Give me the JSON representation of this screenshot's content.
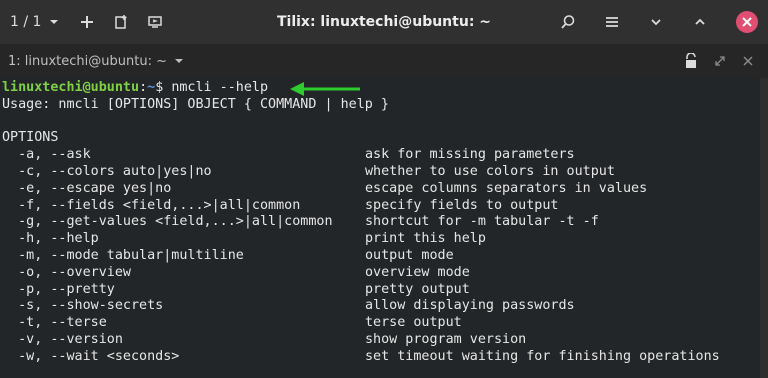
{
  "titlebar": {
    "session_counter": "1 / 1",
    "title": "Tilix: linuxtechi@ubuntu: ~"
  },
  "tab": {
    "label": "1: linuxtechi@ubuntu: ~"
  },
  "terminal": {
    "prompt_user": "linuxtechi@ubuntu",
    "prompt_sep": ":",
    "prompt_path": "~",
    "prompt_sym": "$ ",
    "command": "nmcli --help",
    "usage": "Usage: nmcli [OPTIONS] OBJECT { COMMAND | help }",
    "options_header": "OPTIONS",
    "options": [
      {
        "flag": "  -a, --ask",
        "desc": "ask for missing parameters"
      },
      {
        "flag": "  -c, --colors auto|yes|no",
        "desc": "whether to use colors in output"
      },
      {
        "flag": "  -e, --escape yes|no",
        "desc": "escape columns separators in values"
      },
      {
        "flag": "  -f, --fields <field,...>|all|common",
        "desc": "specify fields to output"
      },
      {
        "flag": "  -g, --get-values <field,...>|all|common",
        "desc": "shortcut for -m tabular -t -f"
      },
      {
        "flag": "  -h, --help",
        "desc": "print this help"
      },
      {
        "flag": "  -m, --mode tabular|multiline",
        "desc": "output mode"
      },
      {
        "flag": "  -o, --overview",
        "desc": "overview mode"
      },
      {
        "flag": "  -p, --pretty",
        "desc": "pretty output"
      },
      {
        "flag": "  -s, --show-secrets",
        "desc": "allow displaying passwords"
      },
      {
        "flag": "  -t, --terse",
        "desc": "terse output"
      },
      {
        "flag": "  -v, --version",
        "desc": "show program version"
      },
      {
        "flag": "  -w, --wait <seconds>",
        "desc": "set timeout waiting for finishing operations"
      }
    ]
  },
  "colors": {
    "prompt_user": "#7fd045",
    "prompt_path": "#5c8fd6",
    "arrow": "#2ecc2e",
    "close": "#e04f71"
  }
}
